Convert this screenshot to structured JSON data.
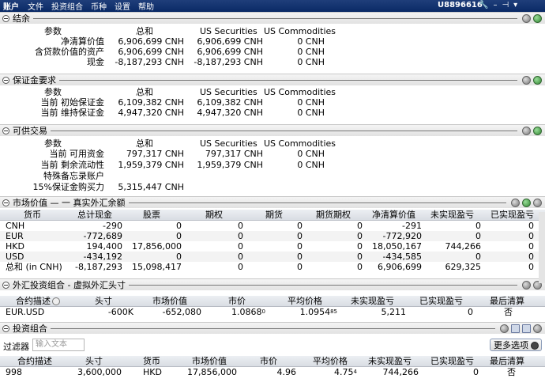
{
  "titlebar": {
    "title": "账户",
    "menu": [
      "文件",
      "投资组合",
      "币种",
      "设置",
      "帮助"
    ],
    "account_id": "U8896616"
  },
  "summary": {
    "title": "结余",
    "headers": [
      "参数",
      "总和",
      "US Securities",
      "US Commodities"
    ],
    "rows": [
      [
        "净清算价值",
        "6,906,699 CNH",
        "6,906,699 CNH",
        "0 CNH"
      ],
      [
        "含贷款价值的资产",
        "6,906,699 CNH",
        "6,906,699 CNH",
        "0 CNH"
      ],
      [
        "现金",
        "-8,187,293 CNH",
        "-8,187,293 CNH",
        "0 CNH"
      ]
    ]
  },
  "margin": {
    "title": "保证金要求",
    "headers": [
      "参数",
      "总和",
      "US Securities",
      "US Commodities"
    ],
    "rows": [
      [
        "当前 初始保证金",
        "6,109,382 CNH",
        "6,109,382 CNH",
        "0 CNH"
      ],
      [
        "当前 维持保证金",
        "4,947,320 CNH",
        "4,947,320 CNH",
        "0 CNH"
      ]
    ]
  },
  "available": {
    "title": "可供交易",
    "headers": [
      "参数",
      "总和",
      "US Securities",
      "US Commodities"
    ],
    "rows": [
      [
        "当前 可用资金",
        "797,317 CNH",
        "797,317 CNH",
        "0 CNH"
      ],
      [
        "当前 剩余流动性",
        "1,959,379 CNH",
        "1,959,379 CNH",
        "0 CNH"
      ],
      [
        "特殊备忘录账户",
        "",
        "",
        ""
      ],
      [
        "15%保证金购买力",
        "5,315,447 CNH",
        "",
        ""
      ]
    ]
  },
  "market": {
    "title": "市场价值 — 一 真实外汇余额",
    "headers": [
      "货币",
      "总计现金",
      "股票",
      "期权",
      "期货",
      "期货期权",
      "净清算价值",
      "未实现盈亏",
      "已实现盈亏"
    ],
    "rows": [
      [
        "CNH",
        "-290",
        "0",
        "0",
        "0",
        "0",
        "-291",
        "0",
        "0"
      ],
      [
        "EUR",
        "-772,689",
        "0",
        "0",
        "0",
        "0",
        "-772,920",
        "0",
        "0"
      ],
      [
        "HKD",
        "194,400",
        "17,856,000",
        "0",
        "0",
        "0",
        "18,050,167",
        "744,266",
        "0"
      ],
      [
        "USD",
        "-434,192",
        "0",
        "0",
        "0",
        "0",
        "-434,585",
        "0",
        "0"
      ],
      [
        "总和 (in CNH)",
        "-8,187,293",
        "15,098,417",
        "0",
        "0",
        "0",
        "6,906,699",
        "629,325",
        "0"
      ]
    ]
  },
  "fx": {
    "title": "外汇投资组合 - 虚拟外汇头寸",
    "headers": [
      "合约描述",
      "头寸",
      "市场价值",
      "市价",
      "平均价格",
      "未实现盈亏",
      "已实现盈亏",
      "最后清算"
    ],
    "rows": [
      {
        "desc": "EUR.USD",
        "pos": "-600K",
        "mv": "-652,080",
        "price": "1.0868",
        "price_sup": "0",
        "avg": "1.0954",
        "avg_sup": "85",
        "upl": "5,211",
        "rpl": "0",
        "last": "否"
      }
    ]
  },
  "portfolio": {
    "title": "投资组合",
    "filter_label": "过滤器",
    "filter_placeholder": "输入文本",
    "more_button": "更多选项",
    "headers": [
      "合约描述",
      "头寸",
      "货币",
      "市场价值",
      "市价",
      "平均价格",
      "未实现盈亏",
      "已实现盈亏",
      "最后清算"
    ],
    "rows": [
      {
        "desc": "998",
        "pos": "3,600,000",
        "cur": "HKD",
        "mv": "17,856,000",
        "price": "4.96",
        "avg": "4.75",
        "avg_sup": "4",
        "upl": "744,266",
        "rpl": "0",
        "last": "否"
      }
    ]
  }
}
